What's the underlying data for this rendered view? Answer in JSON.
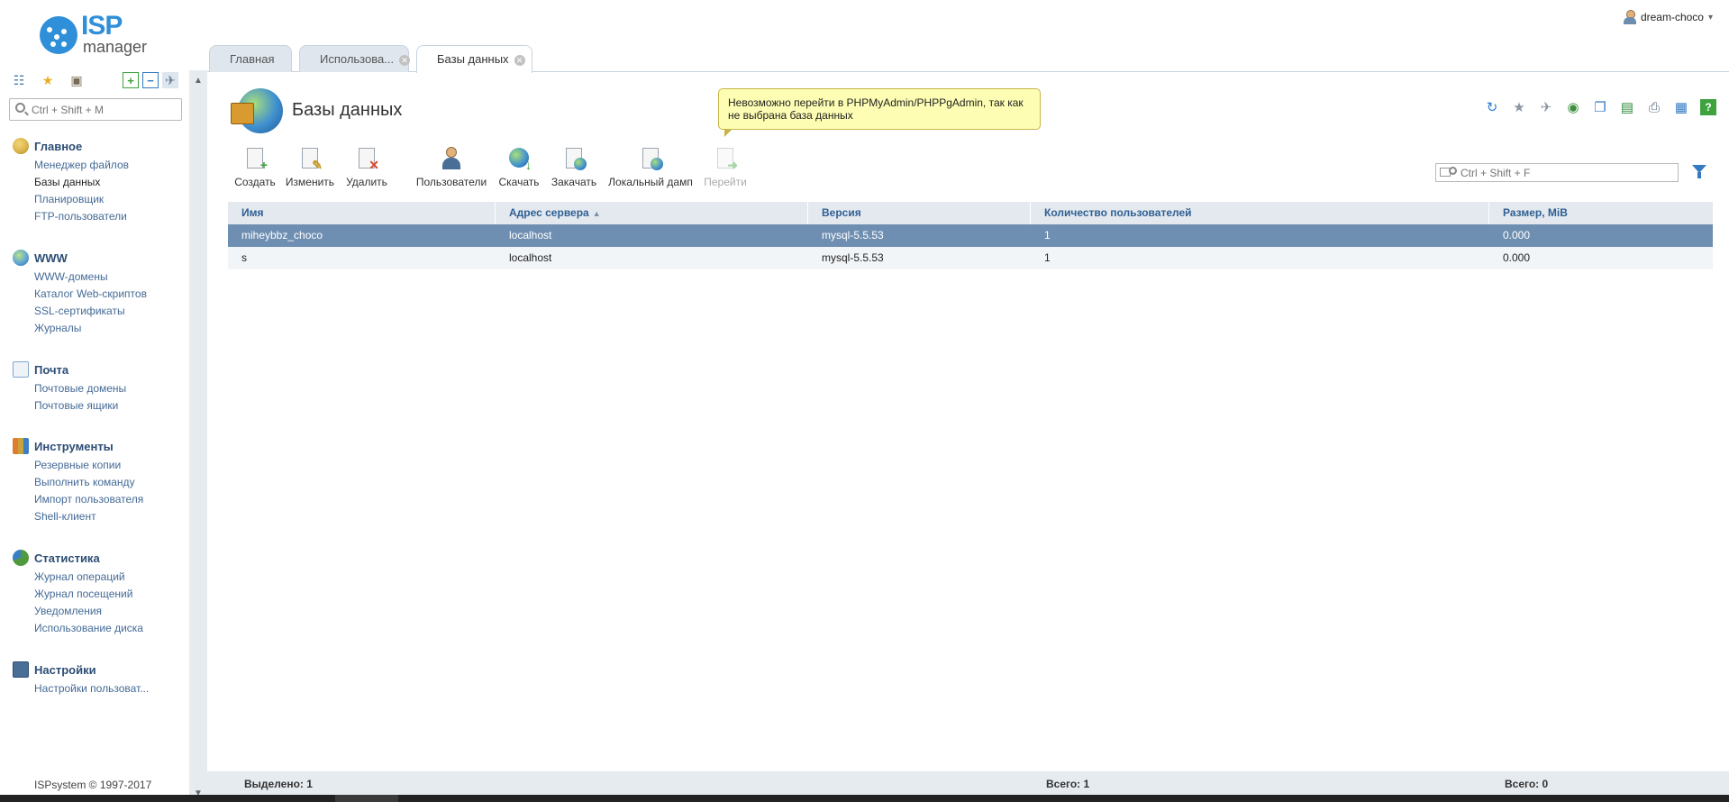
{
  "app": {
    "logo_line1": "ISP",
    "logo_line2": "manager",
    "user_name": "dream-choco",
    "copyright": "ISPsystem © 1997-2017"
  },
  "sidebar": {
    "search_placeholder": "Ctrl + Shift + M",
    "tool_icons": [
      "tree-view-icon",
      "favorites-star-icon",
      "briefcase-icon",
      "expand-all-icon",
      "collapse-all-icon",
      "pin-icon"
    ],
    "groups": [
      {
        "title": "Главное",
        "icon": "home-globe-icon",
        "color": "#d8b247",
        "items": [
          "Менеджер файлов",
          "Базы данных",
          "Планировщик",
          "FTP-пользователи"
        ],
        "active_item": "Базы данных"
      },
      {
        "title": "WWW",
        "icon": "www-globe-icon",
        "color": "#5aa0d8",
        "items": [
          "WWW-домены",
          "Каталог Web-скриптов",
          "SSL-сертификаты",
          "Журналы"
        ]
      },
      {
        "title": "Почта",
        "icon": "mail-icon",
        "color": "#7fa7cf",
        "items": [
          "Почтовые домены",
          "Почтовые ящики"
        ]
      },
      {
        "title": "Инструменты",
        "icon": "tools-icon",
        "color": "#e07c2e",
        "items": [
          "Резервные копии",
          "Выполнить команду",
          "Импорт пользователя",
          "Shell-клиент"
        ]
      },
      {
        "title": "Статистика",
        "icon": "statistics-pie-icon",
        "color": "#4f9a3f",
        "items": [
          "Журнал операций",
          "Журнал посещений",
          "Уведомления",
          "Использование диска"
        ]
      },
      {
        "title": "Настройки",
        "icon": "settings-monitor-icon",
        "color": "#4a6f96",
        "items": [
          "Настройки пользоват..."
        ]
      }
    ]
  },
  "tabs": [
    {
      "label": "Главная",
      "closable": false,
      "active": false
    },
    {
      "label": "Использова...",
      "closable": true,
      "active": false
    },
    {
      "label": "Базы данных",
      "closable": true,
      "active": true
    }
  ],
  "page": {
    "title": "Базы данных",
    "tooltip": "Невозможно перейти в PHPMyAdmin/PHPPgAdmin, так как не выбрана база данных",
    "right_icons": [
      "refresh-icon",
      "add-to-favorites-icon",
      "pin-icon",
      "help-circle-icon",
      "copy-icon",
      "export-excel-icon",
      "print-icon",
      "table-settings-icon",
      "help-icon"
    ]
  },
  "toolbar": {
    "buttons": [
      {
        "label": "Создать",
        "icon": "create-icon",
        "enabled": true
      },
      {
        "label": "Изменить",
        "icon": "edit-icon",
        "enabled": true
      },
      {
        "label": "Удалить",
        "icon": "delete-icon",
        "enabled": true
      },
      {
        "label": "Пользователи",
        "icon": "users-icon",
        "enabled": true
      },
      {
        "label": "Скачать",
        "icon": "download-icon",
        "enabled": true
      },
      {
        "label": "Закачать",
        "icon": "upload-icon",
        "enabled": true
      },
      {
        "label": "Локальный дамп",
        "icon": "local-dump-icon",
        "enabled": true
      },
      {
        "label": "Перейти",
        "icon": "go-to-icon",
        "enabled": false
      }
    ],
    "search_placeholder": "Ctrl + Shift + F"
  },
  "table": {
    "columns": [
      "Имя",
      "Адрес сервера",
      "Версия",
      "Количество пользователей",
      "Размер, MiB"
    ],
    "sorted_column": "Адрес сервера",
    "rows": [
      {
        "cells": [
          "miheybbz_choco",
          "localhost",
          "mysql-5.5.53",
          "1",
          "0.000"
        ],
        "selected": true
      },
      {
        "cells": [
          "s",
          "localhost",
          "mysql-5.5.53",
          "1",
          "0.000"
        ],
        "selected": false
      }
    ]
  },
  "footer": {
    "selected": "Выделено: 1",
    "total": "Всего: 1",
    "total2": "Всего: 0"
  },
  "colors": {
    "accent": "#2f8fd8",
    "selected_row": "#6f8fb2",
    "header_row": "#e3e9ef",
    "nav_link": "#446a96"
  }
}
